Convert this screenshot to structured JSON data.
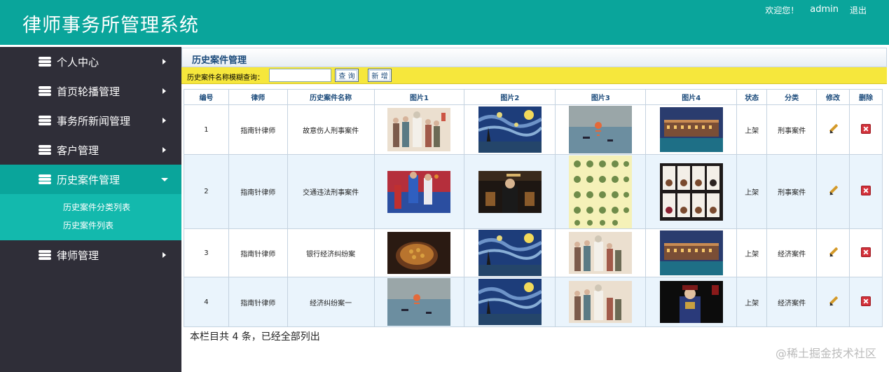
{
  "header": {
    "title": "律师事务所管理系统",
    "welcome": "欢迎您！",
    "user": "admin",
    "logout": "退出"
  },
  "sidebar": {
    "items": [
      {
        "label": "个人中心"
      },
      {
        "label": "首页轮播管理"
      },
      {
        "label": "事务所新闻管理"
      },
      {
        "label": "客户管理"
      },
      {
        "label": "历史案件管理"
      },
      {
        "label": "律师管理"
      }
    ],
    "subitems": [
      "历史案件分类列表",
      "历史案件列表"
    ]
  },
  "breadcrumb": "历史案件管理",
  "search": {
    "label": "历史案件名称模糊查询：",
    "value": "",
    "query_label": "查 询",
    "add_label": "新 增"
  },
  "table": {
    "headers": [
      "编号",
      "律师",
      "历史案件名称",
      "图片1",
      "图片2",
      "图片3",
      "图片4",
      "状态",
      "分类",
      "修改",
      "删除"
    ],
    "rows": [
      {
        "id": "1",
        "lawyer": "指南针律师",
        "name": "故意伤人刑事案件",
        "img1": "figures-painting",
        "img2": "starry-night",
        "img3": "impression-sunrise",
        "img4": "hotel-night",
        "status": "上架",
        "category": "刑事案件"
      },
      {
        "id": "2",
        "lawyer": "指南针律师",
        "name": "交通违法刑事案件",
        "img1": "basketball",
        "img2": "man-stage",
        "img3": "herb-chart",
        "img4": "tea-grid",
        "status": "上架",
        "category": "刑事案件"
      },
      {
        "id": "3",
        "lawyer": "指南针律师",
        "name": "银行经济纠纷案",
        "img1": "food-bowl",
        "img2": "starry-night",
        "img3": "figures-painting",
        "img4": "hotel-night",
        "status": "上架",
        "category": "经济案件"
      },
      {
        "id": "4",
        "lawyer": "指南针律师",
        "name": "经济纠纷案一",
        "img1": "impression-sunrise",
        "img2": "starry-night",
        "img3": "figures-painting",
        "img4": "qing-costume",
        "status": "上架",
        "category": "经济案件"
      }
    ]
  },
  "footer_note": "本栏目共 4 条，已经全部列出",
  "watermark": "@稀土掘金技术社区"
}
